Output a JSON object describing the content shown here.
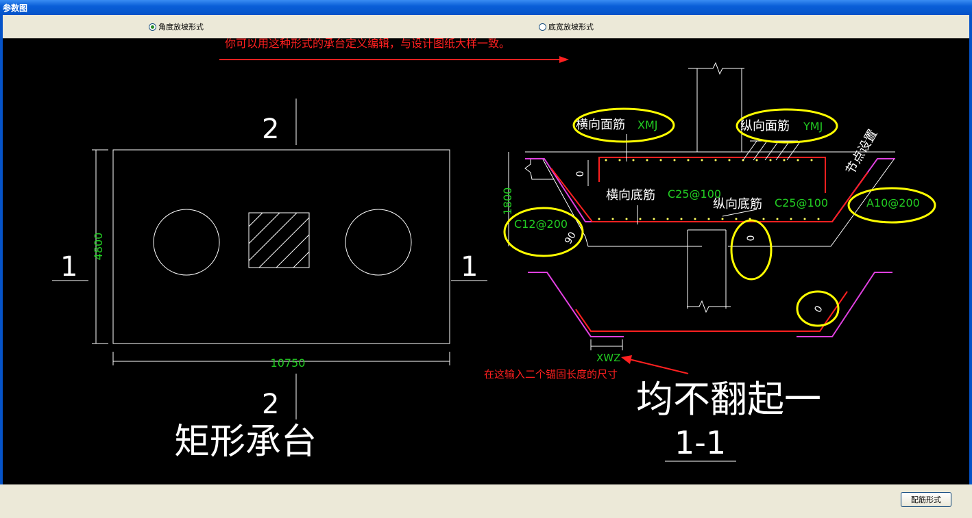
{
  "window": {
    "title": "参数图"
  },
  "options": {
    "angle_slope": "角度放坡形式",
    "width_slope": "底宽放坡形式",
    "selected": "angle_slope"
  },
  "drawing": {
    "hint_top": "你可以用这种形式的承台定义编辑，与设计图纸大样一致。",
    "section_top": "2",
    "section_bottom": "2",
    "section_left": "1",
    "section_right": "1",
    "dim_height": "4800",
    "dim_length": "10750",
    "plan_title": "矩形承台",
    "label_xmj_cn": "横向面筋",
    "label_xmj": "XMJ",
    "label_ymj_cn": "纵向面筋",
    "label_ymj": "YMJ",
    "label_node": "节点设置",
    "label_xdj_cn": "横向底筋",
    "label_xdj": "C25@100",
    "label_ydj_cn": "纵向底筋",
    "label_ydj": "C25@100",
    "label_side": "C12@200",
    "label_stirrup": "A10@200",
    "dim_section_h": "1800",
    "val_zero_1": "0",
    "val_zero_2": "0",
    "val_zero_3": "0",
    "val_ninety": "90",
    "label_xwz": "XWZ",
    "hint_anchor": "在这输入二个锚固长度的尺寸",
    "section_note": "均不翻起一",
    "section_title": "1-1"
  },
  "buttons": {
    "rebar_form": "配筋形式"
  },
  "colors": {
    "title_bar": "#0553c8",
    "canvas": "#000000",
    "rebar": "#ff0000",
    "slope": "#e040e0",
    "dim": "#22cc22",
    "highlight": "#ffff00"
  }
}
